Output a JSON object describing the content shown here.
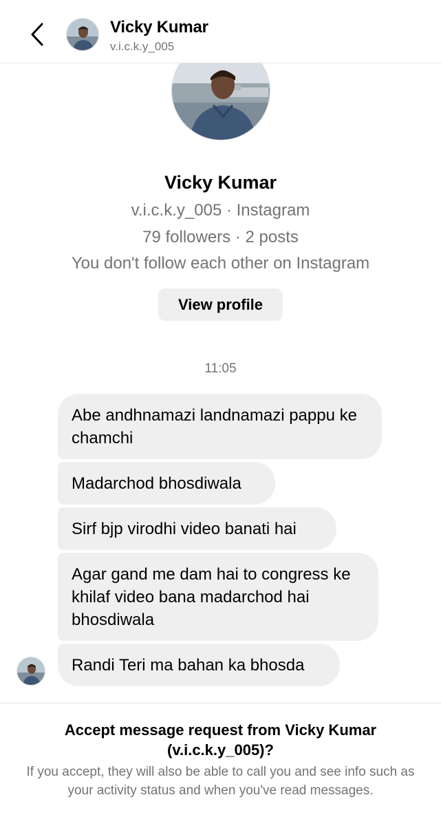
{
  "header": {
    "name": "Vicky Kumar",
    "handle": "v.i.c.k.y_005",
    "back_icon": "chevron-left-icon"
  },
  "profile": {
    "name": "Vicky Kumar",
    "handle_line": "v.i.c.k.y_005 · Instagram",
    "stats_line": "79 followers · 2 posts",
    "relation_line": "You don't follow each other on Instagram",
    "view_profile_label": "View profile"
  },
  "conversation": {
    "timestamp": "11:05",
    "messages": [
      "Abe andhnamazi landnamazi pappu ke chamchi",
      "Madarchod bhosdiwala",
      "Sirf bjp virodhi video banati hai",
      "Agar gand me dam hai to congress ke khilaf video bana madarchod hai bhosdiwala",
      "Randi Teri ma bahan ka bhosda"
    ]
  },
  "request": {
    "title": "Accept message request from Vicky Kumar (v.i.c.k.y_005)?",
    "body": "If you accept, they will also be able to call you and see info such as your activity status and when you've read messages."
  },
  "colors": {
    "bubble": "#efefef",
    "secondary_text": "#737373",
    "divider": "#e6e6e6"
  }
}
